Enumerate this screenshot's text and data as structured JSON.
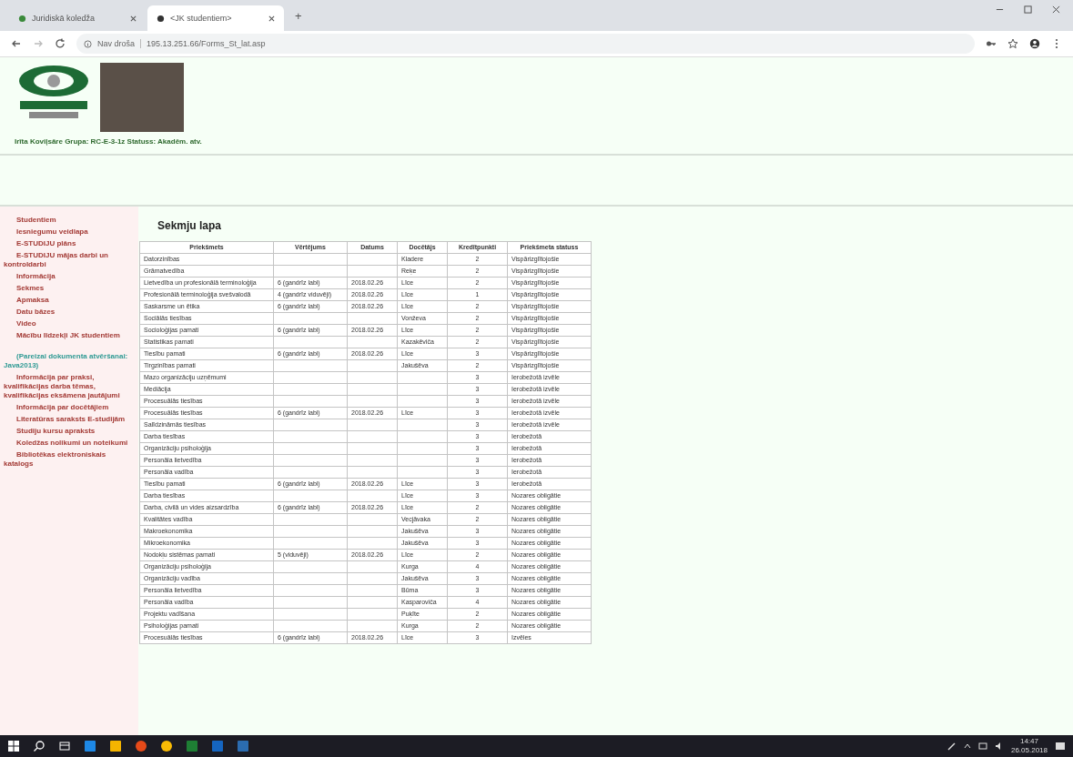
{
  "browser": {
    "tabs": [
      {
        "title": "Juridiskā koledža",
        "selected": false
      },
      {
        "title": "<JK studentiem>",
        "selected": true
      }
    ],
    "new_tab": "+",
    "address": {
      "security": "Nav droša",
      "url": "195.13.251.66/Forms_St_lat.asp"
    }
  },
  "header": {
    "student_line": "Irīta Koviļsāre Grupa: RC-E-3-1z Statuss: Akadēm. atv."
  },
  "sidebar": {
    "items": [
      {
        "label": "Studentiem",
        "kind": "link"
      },
      {
        "label": "Iesniegumu veidlapa",
        "kind": "link"
      },
      {
        "label": "E-STUDIJU plāns",
        "kind": "link"
      },
      {
        "label": "E-STUDIJU mājas darbi un kontroldarbi",
        "kind": "link"
      },
      {
        "label": "Informācija",
        "kind": "link"
      },
      {
        "label": "Sekmes",
        "kind": "link"
      },
      {
        "label": "Apmaksa",
        "kind": "link"
      },
      {
        "label": "Datu bāzes",
        "kind": "link"
      },
      {
        "label": "Video",
        "kind": "link"
      },
      {
        "label": "Mācību līdzekļi JK studentiem",
        "kind": "link"
      },
      {
        "label": "(Pareizai dokumenta atvēršanai: Java2013)",
        "kind": "note"
      },
      {
        "label": "Informācija par praksi, kvalifikācijas darba tēmas, kvalifikācijas eksāmena jautājumi",
        "kind": "link"
      },
      {
        "label": "Informācija par docētājiem",
        "kind": "link"
      },
      {
        "label": "Literatūras saraksts E-studijām",
        "kind": "link"
      },
      {
        "label": "Studiju kursu apraksts",
        "kind": "link"
      },
      {
        "label": "Koledžas nolikumi un noteikumi",
        "kind": "link"
      },
      {
        "label": "Bibliotēkas elektroniskais katalogs",
        "kind": "link"
      }
    ]
  },
  "page": {
    "title": "Sekmju lapa",
    "table": {
      "columns": [
        "Priekšmets",
        "Vērtējums",
        "Datums",
        "Docētājs",
        "Kredītpunkti",
        "Priekšmeta statuss"
      ],
      "rows": [
        [
          "Datorzinības",
          "",
          "",
          "Kladere",
          "2",
          "Vispārizglītojošie"
        ],
        [
          "Grāmatvedība",
          "",
          "",
          "Reķe",
          "2",
          "Vispārizglītojošie"
        ],
        [
          "Lietvedība un profesionālā terminoloģija",
          "6 (gandrīz labi)",
          "2018.02.26",
          "Līce",
          "2",
          "Vispārizglītojošie"
        ],
        [
          "Profesionālā terminoloģija svešvalodā",
          "4 (gandrīz viduvēji)",
          "2018.02.26",
          "Līce",
          "1",
          "Vispārizglītojošie"
        ],
        [
          "Saskarsme un ētika",
          "6 (gandrīz labi)",
          "2018.02.26",
          "Līce",
          "2",
          "Vispārizglītojošie"
        ],
        [
          "Sociālās tiesības",
          "",
          "",
          "Vonževa",
          "2",
          "Vispārizglītojošie"
        ],
        [
          "Socioloģijas pamati",
          "6 (gandrīz labi)",
          "2018.02.26",
          "Līce",
          "2",
          "Vispārizglītojošie"
        ],
        [
          "Statistikas pamati",
          "",
          "",
          "Kazakēviča",
          "2",
          "Vispārizglītojošie"
        ],
        [
          "Tiesību pamati",
          "6 (gandrīz labi)",
          "2018.02.26",
          "Līce",
          "3",
          "Vispārizglītojošie"
        ],
        [
          "Tirgzinības pamati",
          "",
          "",
          "Jakušēva",
          "2",
          "Vispārizglītojošie"
        ],
        [
          "Mazo organizāciju uzņēmumi",
          "",
          "",
          "",
          "3",
          "Ierobežotā izvēle"
        ],
        [
          "Mediācija",
          "",
          "",
          "",
          "3",
          "Ierobežotā izvēle"
        ],
        [
          "Procesuālās tiesības",
          "",
          "",
          "",
          "3",
          "Ierobežotā izvēle"
        ],
        [
          "Procesuālās tiesības",
          "6 (gandrīz labi)",
          "2018.02.26",
          "Līce",
          "3",
          "Ierobežotā izvēle"
        ],
        [
          "Salīdzināmās tiesības",
          "",
          "",
          "",
          "3",
          "Ierobežotā izvēle"
        ],
        [
          "Darba tiesības",
          "",
          "",
          "",
          "3",
          "Ierobežotā"
        ],
        [
          "Organizāciju psiholoģija",
          "",
          "",
          "",
          "3",
          "Ierobežotā"
        ],
        [
          "Personāla lietvedība",
          "",
          "",
          "",
          "3",
          "Ierobežotā"
        ],
        [
          "Personāla vadība",
          "",
          "",
          "",
          "3",
          "Ierobežotā"
        ],
        [
          "Tiesību pamati",
          "6 (gandrīz labi)",
          "2018.02.26",
          "Līce",
          "3",
          "Ierobežotā"
        ],
        [
          "Darba tiesības",
          "",
          "",
          "Līce",
          "3",
          "Nozares obligātie"
        ],
        [
          "Darba, civilā un vides aizsardzība",
          "6 (gandrīz labi)",
          "2018.02.26",
          "Līce",
          "2",
          "Nozares obligātie"
        ],
        [
          "Kvalitātes vadība",
          "",
          "",
          "Vecjāvaka",
          "2",
          "Nozares obligātie"
        ],
        [
          "Makroekonomika",
          "",
          "",
          "Jakušēva",
          "3",
          "Nozares obligātie"
        ],
        [
          "Mikroekonomika",
          "",
          "",
          "Jakušēva",
          "3",
          "Nozares obligātie"
        ],
        [
          "Nodokļu sistēmas pamati",
          "5 (viduvēji)",
          "2018.02.26",
          "Līce",
          "2",
          "Nozares obligātie"
        ],
        [
          "Organizāciju psiholoģija",
          "",
          "",
          "Kurga",
          "4",
          "Nozares obligātie"
        ],
        [
          "Organizāciju vadība",
          "",
          "",
          "Jakušēva",
          "3",
          "Nozares obligātie"
        ],
        [
          "Personāla lietvedība",
          "",
          "",
          "Būma",
          "3",
          "Nozares obligātie"
        ],
        [
          "Personāla vadība",
          "",
          "",
          "Kasparoviča",
          "4",
          "Nozares obligātie"
        ],
        [
          "Projektu vadīšana",
          "",
          "",
          "Puķīte",
          "2",
          "Nozares obligātie"
        ],
        [
          "Psiholoģijas pamati",
          "",
          "",
          "Kurga",
          "2",
          "Nozares obligātie"
        ],
        [
          "Procesuālās tiesības",
          "6 (gandrīz labi)",
          "2018.02.26",
          "Līce",
          "3",
          "Izvēles"
        ]
      ]
    }
  },
  "taskbar": {
    "time": "14:47",
    "date": "26.05.2018"
  }
}
